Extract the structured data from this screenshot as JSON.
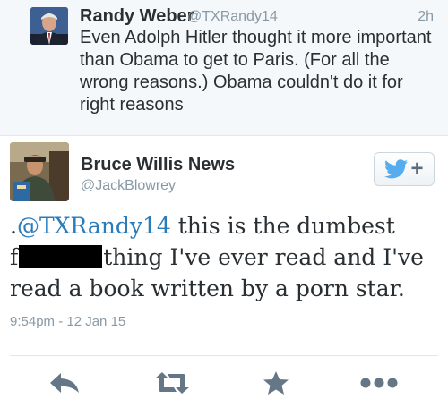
{
  "reply_tweet": {
    "author_name": "Randy Weber",
    "author_handle": "@TXRandy14",
    "time": "2h",
    "text": "Even Adolph Hitler thought it more important than Obama to get to Paris. (For all the wrong reasons.) Obama couldn't do it for right reasons"
  },
  "main_tweet": {
    "author_name": "Bruce Willis News",
    "author_handle": "@JackBlowrey",
    "text_prefix": ".",
    "mention": "@TXRandy14",
    "text_part1": " this is the dumbest",
    "text_line2_start": "f",
    "text_part2": "thing I've ever read and I've read a book written by a porn star.",
    "timestamp": "9:54pm - 12 Jan 15",
    "follow_label": "+"
  },
  "actions": [
    {
      "icon": "reply-icon"
    },
    {
      "icon": "retweet-icon"
    },
    {
      "icon": "favorite-star-icon"
    },
    {
      "icon": "more-options-icon"
    }
  ],
  "colors": {
    "mention": "#2b7bb9",
    "twitter_bird": "#55acee",
    "action_icon": "#657786",
    "muted": "#8899a6"
  }
}
